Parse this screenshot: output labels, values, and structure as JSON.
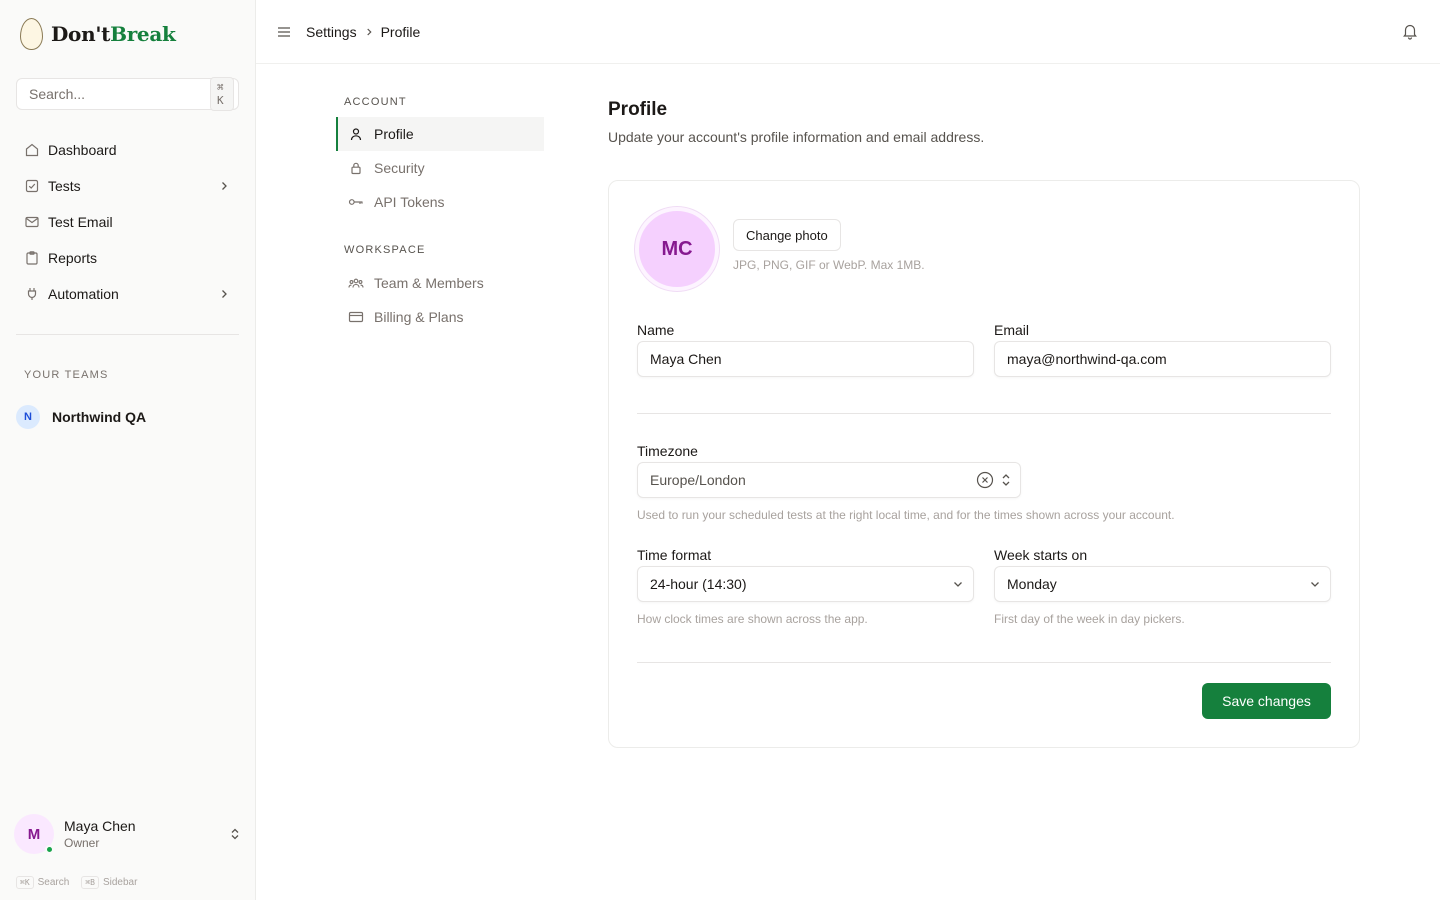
{
  "brand": {
    "part1": "Don't",
    "part2": "Break",
    "brand_color": "#15803d"
  },
  "search": {
    "placeholder": "Search...",
    "shortcut": "⌘ K"
  },
  "nav": {
    "items": [
      {
        "label": "Dashboard",
        "icon": "home-icon"
      },
      {
        "label": "Tests",
        "icon": "checkbox-icon",
        "has_children": true
      },
      {
        "label": "Test Email",
        "icon": "mail-icon"
      },
      {
        "label": "Reports",
        "icon": "clipboard-icon"
      },
      {
        "label": "Automation",
        "icon": "plug-icon",
        "has_children": true
      }
    ]
  },
  "teams": {
    "heading": "YOUR TEAMS",
    "items": [
      {
        "initial": "N",
        "name": "Northwind QA"
      }
    ]
  },
  "user": {
    "initial": "M",
    "name": "Maya Chen",
    "role": "Owner",
    "status": "online"
  },
  "shortcuts": [
    {
      "key": "⌘K",
      "label": "Search"
    },
    {
      "key": "⌘B",
      "label": "Sidebar"
    }
  ],
  "header": {
    "breadcrumb": [
      "Settings",
      "Profile"
    ]
  },
  "settings_nav": {
    "sections": [
      {
        "heading": "ACCOUNT",
        "items": [
          {
            "label": "Profile",
            "icon": "user-icon",
            "active": true
          },
          {
            "label": "Security",
            "icon": "lock-icon"
          },
          {
            "label": "API Tokens",
            "icon": "key-icon"
          }
        ]
      },
      {
        "heading": "WORKSPACE",
        "items": [
          {
            "label": "Team & Members",
            "icon": "users-icon"
          },
          {
            "label": "Billing & Plans",
            "icon": "credit-card-icon"
          }
        ]
      }
    ]
  },
  "profile": {
    "title": "Profile",
    "subtitle": "Update your account's profile information and email address.",
    "avatar_initials": "MC",
    "change_photo": "Change photo",
    "photo_hint": "JPG, PNG, GIF or WebP. Max 1MB.",
    "name_label": "Name",
    "name_value": "Maya Chen",
    "email_label": "Email",
    "email_value": "maya@northwind-qa.com",
    "timezone_label": "Timezone",
    "timezone_value": "Europe/London",
    "timezone_hint": "Used to run your scheduled tests at the right local time, and for the times shown across your account.",
    "time_format_label": "Time format",
    "time_format_value": "24-hour (14:30)",
    "time_format_hint": "How clock times are shown across the app.",
    "week_start_label": "Week starts on",
    "week_start_value": "Monday",
    "week_start_hint": "First day of the week in day pickers.",
    "save": "Save changes"
  }
}
